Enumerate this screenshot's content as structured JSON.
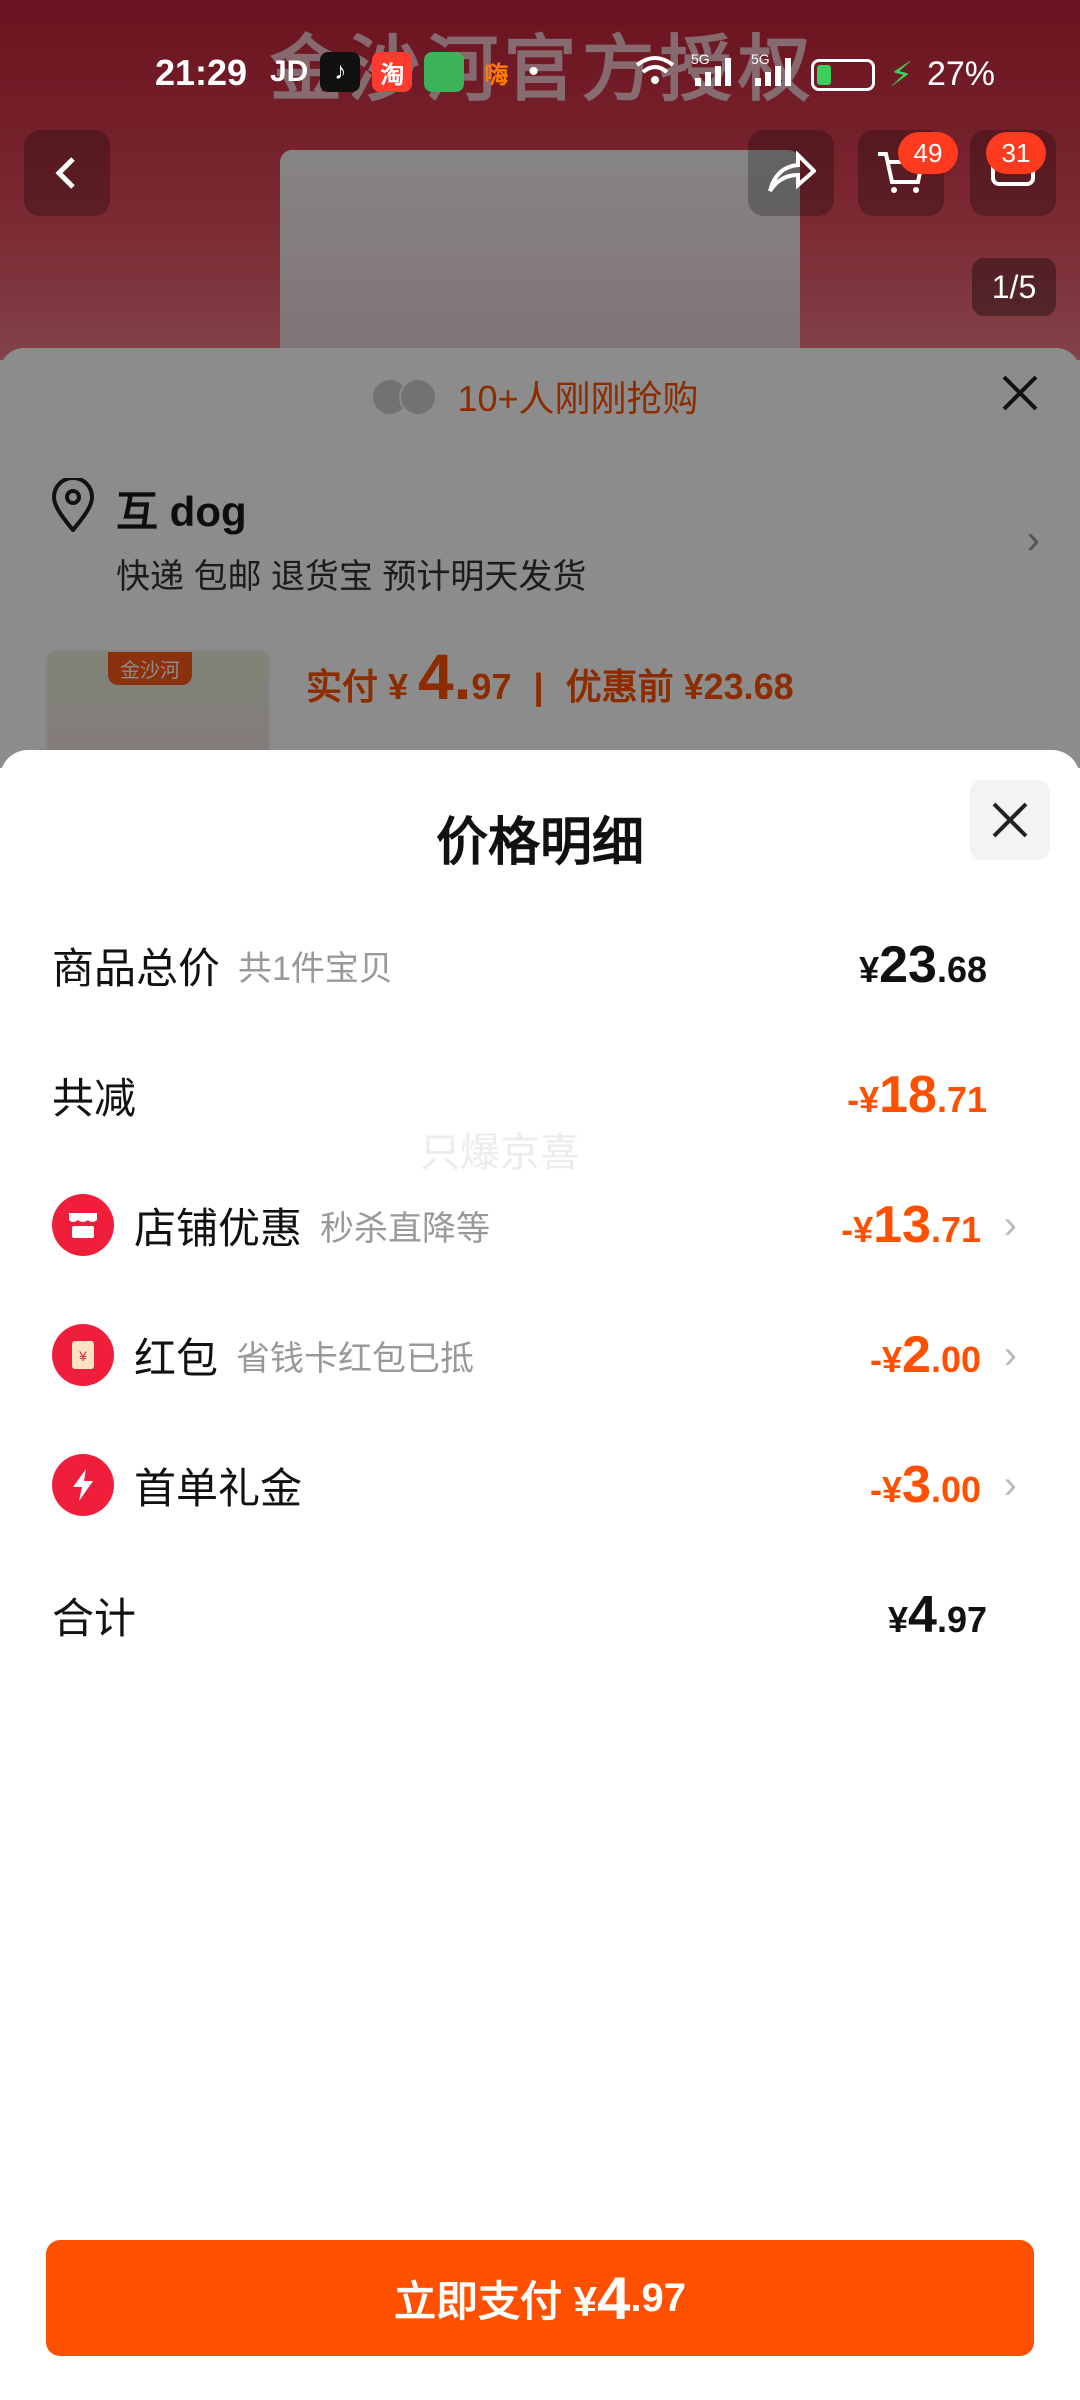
{
  "status_bar": {
    "time": "21:29",
    "apps": [
      "JD",
      "tiktok-icon",
      "淘",
      "app-icon",
      "嗨"
    ],
    "network": "5G",
    "battery": "27%"
  },
  "product_page": {
    "banner_text": "金沙河官方授权",
    "cart_badge": "49",
    "message_badge": "31",
    "image_counter": "1/5"
  },
  "order_sheet": {
    "snatch_text": "10+人刚刚抢购",
    "address": {
      "name": "互 dog",
      "details": "快递 包邮 退货宝 预计明天发货"
    },
    "thumb_tag": "金沙河",
    "pay_label": "实付 ¥",
    "pay_int": "4.",
    "pay_dec": "97",
    "before_label": "优惠前 ¥23.68"
  },
  "price_detail": {
    "title": "价格明细",
    "watermark": "只爆京喜",
    "rows": [
      {
        "label": "商品总价",
        "sub": "共1件宝贝",
        "prefix": "¥",
        "int": "23",
        "dec": ".68"
      },
      {
        "label": "共减",
        "sub": "",
        "prefix": "-¥",
        "int": "18",
        "dec": ".71"
      },
      {
        "label": "店铺优惠",
        "sub": "秒杀直降等",
        "prefix": "-¥",
        "int": "13",
        "dec": ".71"
      },
      {
        "label": "红包",
        "sub": "省钱卡红包已抵",
        "prefix": "-¥",
        "int": "2",
        "dec": ".00"
      },
      {
        "label": "首单礼金",
        "sub": "",
        "prefix": "-¥",
        "int": "3",
        "dec": ".00"
      },
      {
        "label": "合计",
        "sub": "",
        "prefix": "¥",
        "int": "4",
        "dec": ".97"
      }
    ],
    "pay_button": {
      "label": "立即支付 ¥",
      "int": "4",
      "dec": ".97"
    }
  },
  "colors": {
    "accent": "#ff5000",
    "icon_red": "#ef1f3c"
  }
}
